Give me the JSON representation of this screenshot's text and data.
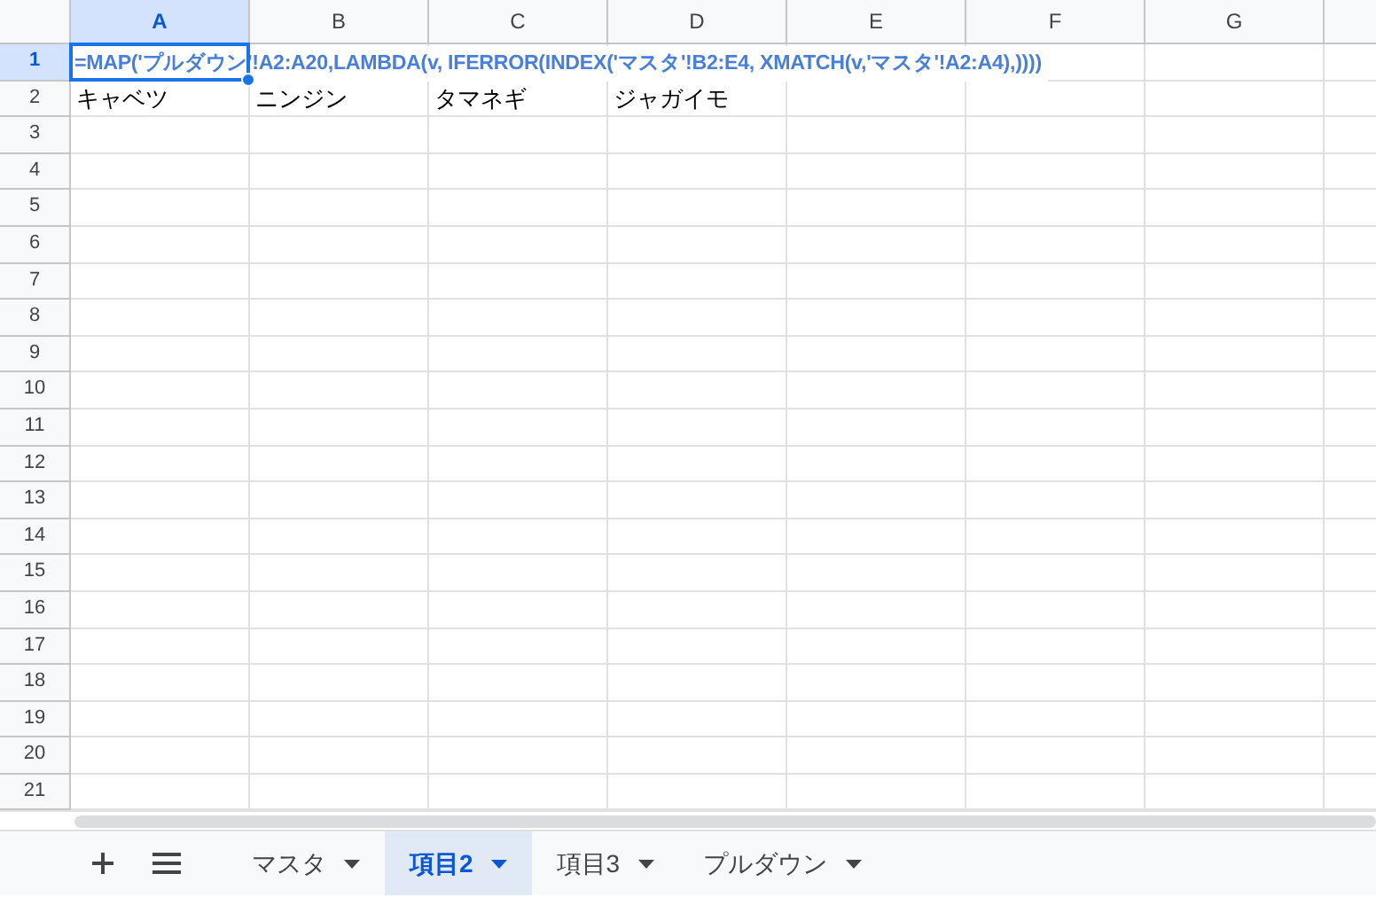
{
  "grid": {
    "columns": [
      {
        "label": "A",
        "selected": true
      },
      {
        "label": "B",
        "selected": false
      },
      {
        "label": "C",
        "selected": false
      },
      {
        "label": "D",
        "selected": false
      },
      {
        "label": "E",
        "selected": false
      },
      {
        "label": "F",
        "selected": false
      },
      {
        "label": "G",
        "selected": false
      }
    ],
    "rows": [
      {
        "label": "1",
        "selected": true,
        "cells": [
          "=MAP('プルダウン'!A2:A20,LAMBDA(v, IFERROR(INDEX('マスタ'!B2:E4, XMATCH(v,'マスタ'!A2:A4),))))"
        ]
      },
      {
        "label": "2",
        "selected": false,
        "cells": [
          "キャベツ",
          "ニンジン",
          "タマネギ",
          "ジャガイモ"
        ]
      },
      {
        "label": "3",
        "selected": false,
        "cells": []
      },
      {
        "label": "4",
        "selected": false,
        "cells": []
      },
      {
        "label": "5",
        "selected": false,
        "cells": []
      },
      {
        "label": "6",
        "selected": false,
        "cells": []
      },
      {
        "label": "7",
        "selected": false,
        "cells": []
      },
      {
        "label": "8",
        "selected": false,
        "cells": []
      },
      {
        "label": "9",
        "selected": false,
        "cells": []
      },
      {
        "label": "10",
        "selected": false,
        "cells": []
      },
      {
        "label": "11",
        "selected": false,
        "cells": []
      },
      {
        "label": "12",
        "selected": false,
        "cells": []
      },
      {
        "label": "13",
        "selected": false,
        "cells": []
      },
      {
        "label": "14",
        "selected": false,
        "cells": []
      },
      {
        "label": "15",
        "selected": false,
        "cells": []
      },
      {
        "label": "16",
        "selected": false,
        "cells": []
      },
      {
        "label": "17",
        "selected": false,
        "cells": []
      },
      {
        "label": "18",
        "selected": false,
        "cells": []
      },
      {
        "label": "19",
        "selected": false,
        "cells": []
      },
      {
        "label": "20",
        "selected": false,
        "cells": []
      },
      {
        "label": "21",
        "selected": false,
        "cells": []
      }
    ]
  },
  "sheet_tabs": [
    {
      "label": "マスタ",
      "selected": false
    },
    {
      "label": "項目2",
      "selected": true
    },
    {
      "label": "項目3",
      "selected": false
    },
    {
      "label": "プルダウン",
      "selected": false
    }
  ]
}
